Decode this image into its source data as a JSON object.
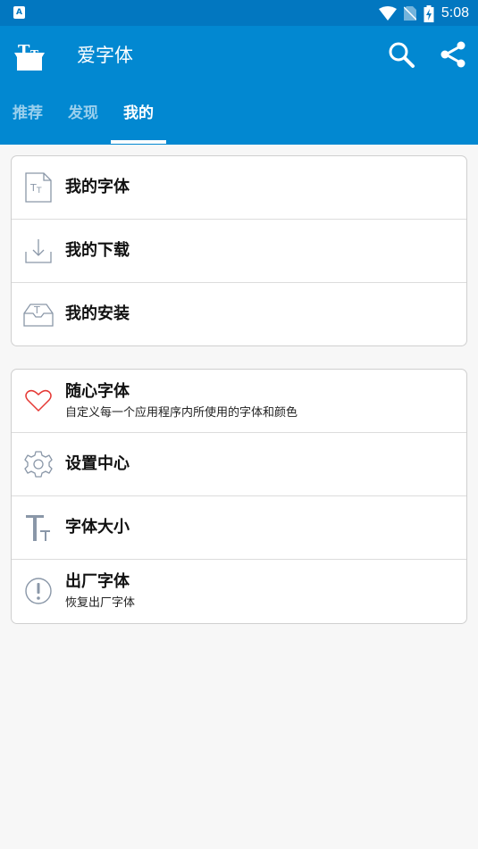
{
  "status_bar": {
    "time": "5:08",
    "notification_icon": "A"
  },
  "app_bar": {
    "title": "爱字体",
    "logo_icon": "font-box-icon",
    "search_icon": "search-icon",
    "share_icon": "share-icon"
  },
  "tabs": [
    {
      "label": "推荐",
      "active": false
    },
    {
      "label": "发现",
      "active": false
    },
    {
      "label": "我的",
      "active": true
    }
  ],
  "section1": {
    "items": [
      {
        "label": "我的字体",
        "icon": "font-file-icon"
      },
      {
        "label": "我的下载",
        "icon": "download-icon"
      },
      {
        "label": "我的安装",
        "icon": "install-tray-icon"
      }
    ]
  },
  "section2": {
    "items": [
      {
        "label": "随心字体",
        "subtitle": "自定义每一个应用程序内所使用的字体和颜色",
        "icon": "heart-icon"
      },
      {
        "label": "设置中心",
        "icon": "gear-icon"
      },
      {
        "label": "字体大小",
        "icon": "text-size-icon"
      },
      {
        "label": "出厂字体",
        "subtitle": "恢复出厂字体",
        "icon": "alert-circle-icon"
      }
    ]
  },
  "colors": {
    "status_bar": "#0277c0",
    "app_bar": "#0288d1",
    "background": "#f7f7f7",
    "icon_gray": "#8a97a8",
    "heart_red": "#e53935"
  }
}
